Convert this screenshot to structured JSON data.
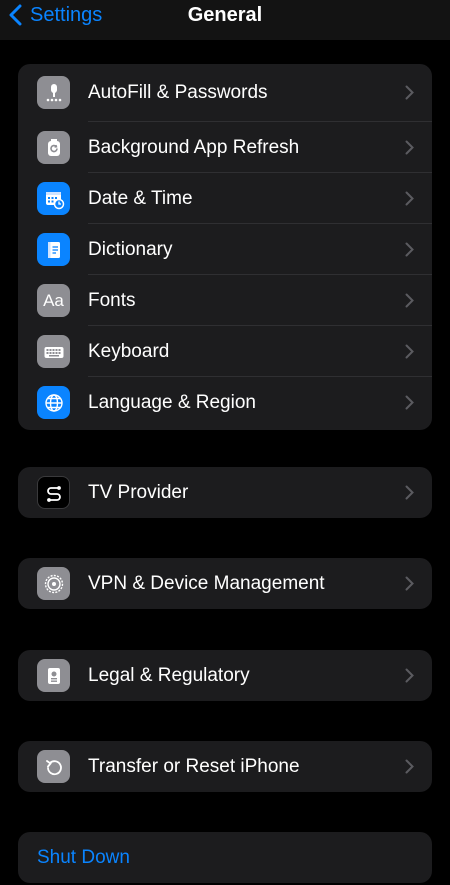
{
  "nav": {
    "back_label": "Settings",
    "title": "General"
  },
  "group1": [
    {
      "label": "AutoFill & Passwords",
      "icon": "key-icon",
      "color": "#8e8e93"
    },
    {
      "label": "Background App Refresh",
      "icon": "refresh-icon",
      "color": "#8e8e93"
    },
    {
      "label": "Date & Time",
      "icon": "calendar-clock-icon",
      "color": "#0a84ff"
    },
    {
      "label": "Dictionary",
      "icon": "book-icon",
      "color": "#0a84ff"
    },
    {
      "label": "Fonts",
      "icon": "fonts-icon",
      "color": "#8e8e93"
    },
    {
      "label": "Keyboard",
      "icon": "keyboard-icon",
      "color": "#8e8e93"
    },
    {
      "label": "Language & Region",
      "icon": "globe-icon",
      "color": "#0a84ff"
    }
  ],
  "group2": {
    "label": "TV Provider",
    "icon": "tv-provider-icon",
    "color": "#000000"
  },
  "group3": {
    "label": "VPN & Device Management",
    "icon": "gear-icon",
    "color": "#8e8e93"
  },
  "group4": {
    "label": "Legal & Regulatory",
    "icon": "document-icon",
    "color": "#8e8e93"
  },
  "group5": {
    "label": "Transfer or Reset iPhone",
    "icon": "reset-icon",
    "color": "#8e8e93"
  },
  "group6": {
    "label": "Shut Down"
  }
}
